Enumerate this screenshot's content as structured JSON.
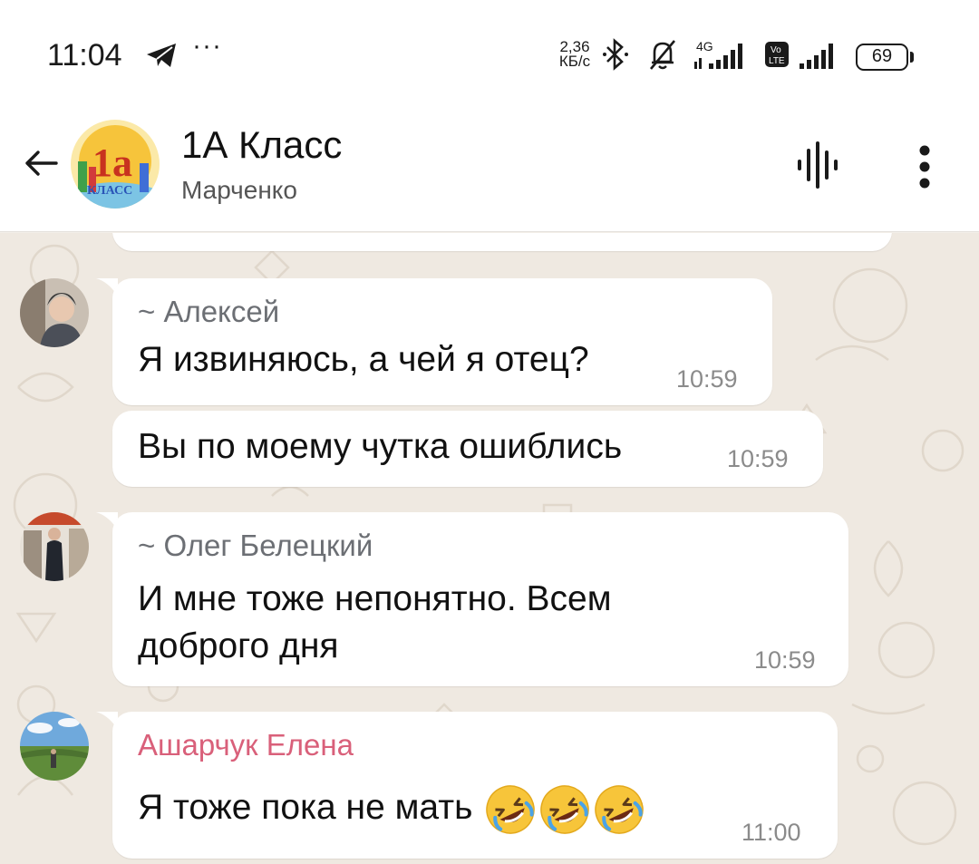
{
  "status_bar": {
    "time": "11:04",
    "more": "···",
    "speed_value": "2,36",
    "speed_unit": "КБ/с",
    "battery": "69",
    "icons": [
      "telegram-icon",
      "bluetooth-icon",
      "muted-bell-icon",
      "signal-4g-icon",
      "volte-signal-icon",
      "battery-icon"
    ]
  },
  "header": {
    "title": "1А Класс",
    "subtitle": "Марченко",
    "avatar_text_top": "1a",
    "avatar_text_bottom": "КЛАСС"
  },
  "messages": [
    {
      "sender": "~ Алексей",
      "text": "Я извиняюсь, а чей я отец?",
      "time": "10:59",
      "avatar": "user-photo-aleksey"
    },
    {
      "sender": "",
      "text": "Вы по моему чутка ошиблись",
      "time": "10:59"
    },
    {
      "sender": "~ Олег Белецкий",
      "text_line1": "И мне тоже непонятно. Всем",
      "text_line2": "доброго дня",
      "time": "10:59",
      "avatar": "user-photo-oleg"
    },
    {
      "sender": "Ашарчук Елена",
      "text": "Я тоже пока не мать",
      "time": "11:00",
      "avatar": "user-photo-elena",
      "emojis": [
        "rolling-laughing-emoji",
        "rolling-laughing-emoji",
        "rolling-laughing-emoji"
      ]
    }
  ],
  "colors": {
    "wallpaper": "#efe9e1",
    "bubble": "#ffffff",
    "sender_gray": "#6c6f74",
    "sender_pink": "#d9607a",
    "time": "#8b8b8b"
  }
}
